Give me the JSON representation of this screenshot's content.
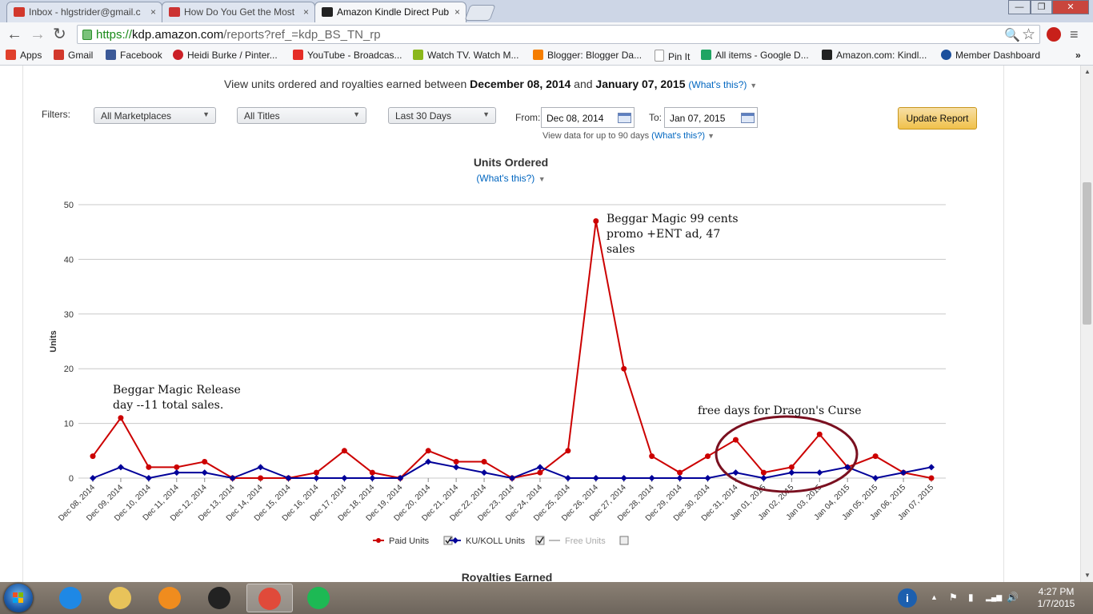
{
  "browser": {
    "tabs": [
      {
        "label": "Inbox - hlgstrider@gmail.c",
        "close": "×"
      },
      {
        "label": "How Do You Get the Most",
        "close": "×"
      },
      {
        "label": "Amazon Kindle Direct Pub",
        "close": "×"
      }
    ],
    "window_buttons": [
      "—",
      "❐",
      "✕"
    ],
    "nav": {
      "back": "←",
      "forward": "→",
      "reload": "↻"
    },
    "url": {
      "scheme": "https://",
      "host": "kdp.amazon.com",
      "path": "/reports?ref_=kdp_BS_TN_rp"
    },
    "omnibox_icons": {
      "search": "🔍",
      "star": "☆",
      "menu": "≡"
    },
    "bookmarks": [
      {
        "label": "Apps",
        "color": "#e0402c"
      },
      {
        "label": "Gmail",
        "color": "#d2382c"
      },
      {
        "label": "Facebook",
        "color": "#3b5998"
      },
      {
        "label": "Heidi Burke / Pinter...",
        "color": "#cb2027"
      },
      {
        "label": "YouTube - Broadcas...",
        "color": "#e52d27"
      },
      {
        "label": "Watch TV. Watch M...",
        "color": "#8ab71b"
      },
      {
        "label": "Blogger: Blogger Da...",
        "color": "#f57d00"
      },
      {
        "label": "Pin It",
        "color": "#dddddd"
      },
      {
        "label": "All items - Google D...",
        "color": "#1fa463"
      },
      {
        "label": "Amazon.com: Kindl...",
        "color": "#222222"
      },
      {
        "label": "Member Dashboard",
        "color": "#1b4f9c"
      }
    ],
    "bookmarks_more": "»"
  },
  "report": {
    "range_prefix": "View units ordered and royalties earned between",
    "range_start": "December 08, 2014",
    "range_and": "and",
    "range_end": "January 07, 2015",
    "whats_this": "(What's this?)",
    "filters_label": "Filters:",
    "marketplace": "All Marketplaces",
    "titles": "All Titles",
    "period": "Last 30 Days",
    "from_label": "From:",
    "from_value": "Dec 08, 2014",
    "to_label": "To:",
    "to_value": "Jan 07, 2015",
    "date_note": "View data for up to 90 days",
    "date_note_help": "(What's this?)",
    "update_button": "Update Report",
    "royalties_title": "Royalties Earned"
  },
  "chart_data": {
    "type": "line",
    "title": "Units Ordered",
    "subtitle": "(What's this?)",
    "ylabel": "Units",
    "ylim": [
      0,
      50
    ],
    "yticks": [
      0,
      10,
      20,
      30,
      40,
      50
    ],
    "grid": true,
    "legend_position": "bottom",
    "categories": [
      "Dec 08, 2014",
      "Dec 09, 2014",
      "Dec 10, 2014",
      "Dec 11, 2014",
      "Dec 12, 2014",
      "Dec 13, 2014",
      "Dec 14, 2014",
      "Dec 15, 2014",
      "Dec 16, 2014",
      "Dec 17, 2014",
      "Dec 18, 2014",
      "Dec 19, 2014",
      "Dec 20, 2014",
      "Dec 21, 2014",
      "Dec 22, 2014",
      "Dec 23, 2014",
      "Dec 24, 2014",
      "Dec 25, 2014",
      "Dec 26, 2014",
      "Dec 27, 2014",
      "Dec 28, 2014",
      "Dec 29, 2014",
      "Dec 30, 2014",
      "Dec 31, 2014",
      "Jan 01, 2015",
      "Jan 02, 2015",
      "Jan 03, 2015",
      "Jan 04, 2015",
      "Jan 05, 2015",
      "Jan 06, 2015",
      "Jan 07, 2015"
    ],
    "series": [
      {
        "name": "Paid Units",
        "color": "#cc0000",
        "checked": true,
        "values": [
          4,
          11,
          2,
          2,
          3,
          0,
          0,
          0,
          1,
          5,
          1,
          0,
          5,
          3,
          3,
          0,
          1,
          5,
          47,
          20,
          4,
          1,
          4,
          7,
          1,
          2,
          8,
          2,
          4,
          1,
          0
        ]
      },
      {
        "name": "KU/KOLL Units",
        "color": "#000099",
        "checked": true,
        "values": [
          0,
          2,
          0,
          1,
          1,
          0,
          2,
          0,
          0,
          0,
          0,
          0,
          3,
          2,
          1,
          0,
          2,
          0,
          0,
          0,
          0,
          0,
          0,
          1,
          0,
          1,
          1,
          2,
          0,
          1,
          2
        ]
      },
      {
        "name": "Free Units",
        "color": "#aaaaaa",
        "checked": false,
        "values": []
      }
    ],
    "annotations": [
      {
        "lines": [
          "Beggar Magic Release",
          "day --11 total sales."
        ]
      },
      {
        "lines": [
          "Beggar Magic 99 cents",
          "promo +ENT ad, 47",
          "sales"
        ]
      },
      {
        "lines": [
          "free days for Dragon's Curse"
        ]
      }
    ],
    "highlight_circle_color": "#7a1020"
  },
  "taskbar": {
    "time": "4:27 PM",
    "date": "1/7/2015",
    "apps": [
      {
        "name": "internet-explorer",
        "color": "#1e88e5"
      },
      {
        "name": "file-explorer",
        "color": "#e8c35a"
      },
      {
        "name": "media-player",
        "color": "#f08c1e"
      },
      {
        "name": "camera-app",
        "color": "#222222"
      },
      {
        "name": "chrome",
        "color": "#e04a3a"
      },
      {
        "name": "spotify",
        "color": "#1db954"
      }
    ],
    "tray_glyphs": [
      "▲",
      "⚑",
      "▮",
      "▂▄▆",
      "🔊"
    ]
  }
}
